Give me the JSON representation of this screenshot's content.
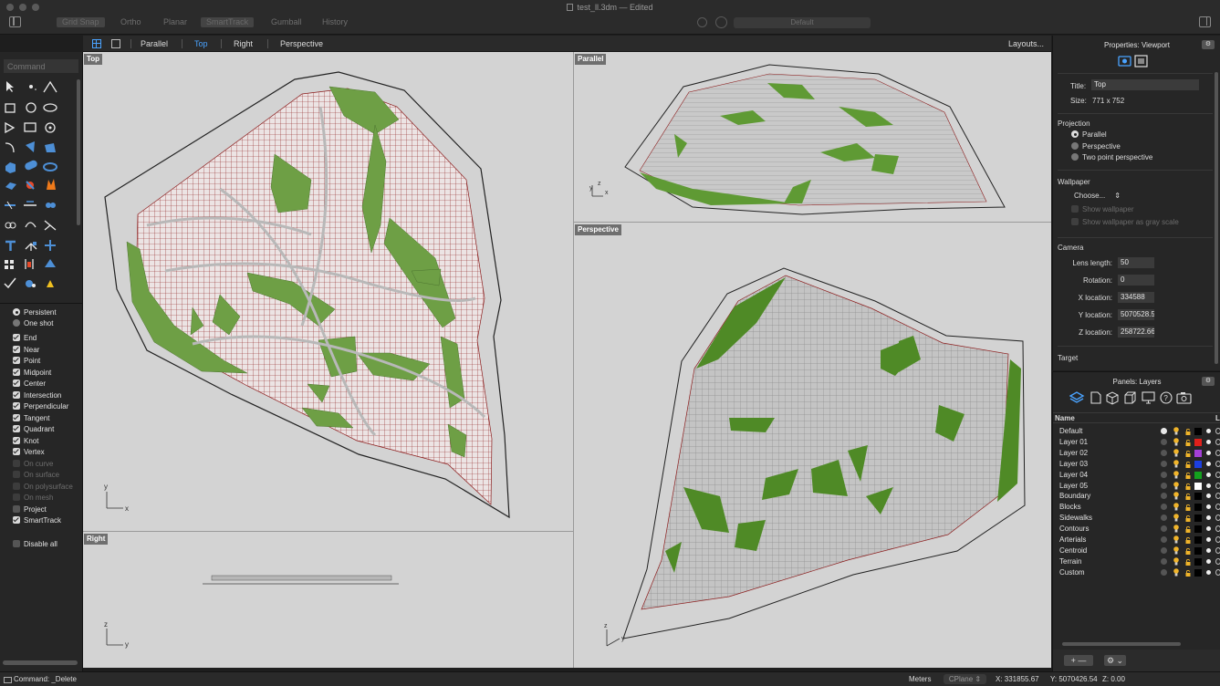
{
  "window": {
    "doc_title": "test_ll.3dm — Edited",
    "toggles": [
      "Grid Snap",
      "Ortho",
      "Planar",
      "SmartTrack",
      "Gumball",
      "History"
    ],
    "layer_field": "Default"
  },
  "viewport_tabs": {
    "items": [
      "Parallel",
      "Top",
      "Right",
      "Perspective"
    ],
    "active": "Top",
    "layouts_label": "Layouts..."
  },
  "toolbox": {
    "command_placeholder": "Command",
    "snap_mode": [
      "Persistent",
      "One shot"
    ],
    "snaps": [
      {
        "label": "End",
        "checked": true,
        "enabled": true
      },
      {
        "label": "Near",
        "checked": true,
        "enabled": true
      },
      {
        "label": "Point",
        "checked": true,
        "enabled": true
      },
      {
        "label": "Midpoint",
        "checked": true,
        "enabled": true
      },
      {
        "label": "Center",
        "checked": true,
        "enabled": true
      },
      {
        "label": "Intersection",
        "checked": true,
        "enabled": true
      },
      {
        "label": "Perpendicular",
        "checked": true,
        "enabled": true
      },
      {
        "label": "Tangent",
        "checked": true,
        "enabled": true
      },
      {
        "label": "Quadrant",
        "checked": true,
        "enabled": true
      },
      {
        "label": "Knot",
        "checked": true,
        "enabled": true
      },
      {
        "label": "Vertex",
        "checked": true,
        "enabled": true
      },
      {
        "label": "On curve",
        "checked": false,
        "enabled": false
      },
      {
        "label": "On surface",
        "checked": false,
        "enabled": false
      },
      {
        "label": "On polysurface",
        "checked": false,
        "enabled": false
      },
      {
        "label": "On mesh",
        "checked": false,
        "enabled": false
      },
      {
        "label": "Project",
        "checked": false,
        "enabled": true
      },
      {
        "label": "SmartTrack",
        "checked": true,
        "enabled": true
      }
    ],
    "disable_all": "Disable all"
  },
  "viewports": {
    "top": "Top",
    "parallel": "Parallel",
    "perspective": "Perspective",
    "right": "Right",
    "axis_x": "x",
    "axis_y": "y",
    "axis_z": "z"
  },
  "properties": {
    "title": "Properties: Viewport",
    "title_label": "Title:",
    "title_value": "Top",
    "size_label": "Size:",
    "size_value": "771 x 752",
    "projection_head": "Projection",
    "projections": [
      "Parallel",
      "Perspective",
      "Two point perspective"
    ],
    "wallpaper_head": "Wallpaper",
    "wallpaper_choose": "Choose...",
    "show_wallpaper": "Show wallpaper",
    "show_gray": "Show wallpaper as gray scale",
    "camera_head": "Camera",
    "camera": [
      {
        "label": "Lens length:",
        "value": "50"
      },
      {
        "label": "Rotation:",
        "value": "0"
      },
      {
        "label": "X location:",
        "value": "334588"
      },
      {
        "label": "Y location:",
        "value": "5070528.5"
      },
      {
        "label": "Z location:",
        "value": "258722.66"
      }
    ],
    "target_head": "Target"
  },
  "layers": {
    "title": "Panels: Layers",
    "col_name": "Name",
    "col_extra": "L",
    "rows": [
      {
        "name": "Default",
        "color": "#000000",
        "current": true
      },
      {
        "name": "Layer 01",
        "color": "#e0201b",
        "current": false
      },
      {
        "name": "Layer 02",
        "color": "#a33fd6",
        "current": false
      },
      {
        "name": "Layer 03",
        "color": "#1c3fe0",
        "current": false
      },
      {
        "name": "Layer 04",
        "color": "#14a01e",
        "current": false
      },
      {
        "name": "Layer 05",
        "color": "#ffffff",
        "current": false
      },
      {
        "name": "Boundary",
        "color": "#000000",
        "current": false
      },
      {
        "name": "Blocks",
        "color": "#000000",
        "current": false
      },
      {
        "name": "Sidewalks",
        "color": "#000000",
        "current": false
      },
      {
        "name": "Contours",
        "color": "#000000",
        "current": false
      },
      {
        "name": "Arterials",
        "color": "#000000",
        "current": false
      },
      {
        "name": "Centroid",
        "color": "#000000",
        "current": false
      },
      {
        "name": "Terrain",
        "color": "#000000",
        "current": false
      },
      {
        "name": "Custom",
        "color": "#000000",
        "current": false
      }
    ]
  },
  "status": {
    "command": "Command: _Delete",
    "units": "Meters",
    "cplane": "CPlane",
    "x": "X: 331855.67",
    "y": "Y: 5070426.54",
    "z": "Z: 0.00"
  },
  "colors": {
    "park_green": "#6e9f45",
    "block_fill": "#e8dede",
    "block_outline": "#8c1d1d",
    "accent_blue": "#4aa3ff"
  }
}
